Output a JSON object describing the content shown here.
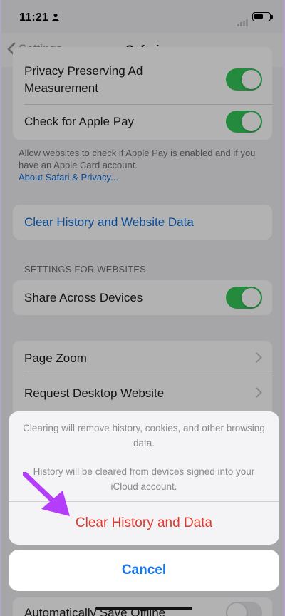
{
  "status_bar": {
    "time": "11:21"
  },
  "nav": {
    "back_label": "Settings",
    "title": "Safari"
  },
  "privacy_group": {
    "rows": [
      {
        "label": "Privacy Preserving Ad Measurement",
        "toggle": "on"
      },
      {
        "label": "Check for Apple Pay",
        "toggle": "on"
      }
    ],
    "footer": "Allow websites to check if Apple Pay is enabled and if you have an Apple Card account.",
    "footer_link": "About Safari & Privacy..."
  },
  "clear_group": {
    "label": "Clear History and Website Data"
  },
  "websites_section": {
    "header": "SETTINGS FOR WEBSITES",
    "share_label": "Share Across Devices",
    "share_toggle": "on"
  },
  "website_settings": {
    "rows": [
      {
        "label": "Page Zoom"
      },
      {
        "label": "Request Desktop Website"
      }
    ]
  },
  "bottom_row": {
    "label": "Automatically Save Offline",
    "toggle": "off"
  },
  "action_sheet": {
    "message1": "Clearing will remove history, cookies, and other browsing data.",
    "message2": "History will be cleared from devices signed into your iCloud account.",
    "destructive_label": "Clear History and Data",
    "cancel_label": "Cancel"
  },
  "colors": {
    "accent": "#0a6bd8",
    "toggle_on": "#34c759",
    "destructive": "#e0392e",
    "annotation_arrow": "#b43dfa"
  }
}
